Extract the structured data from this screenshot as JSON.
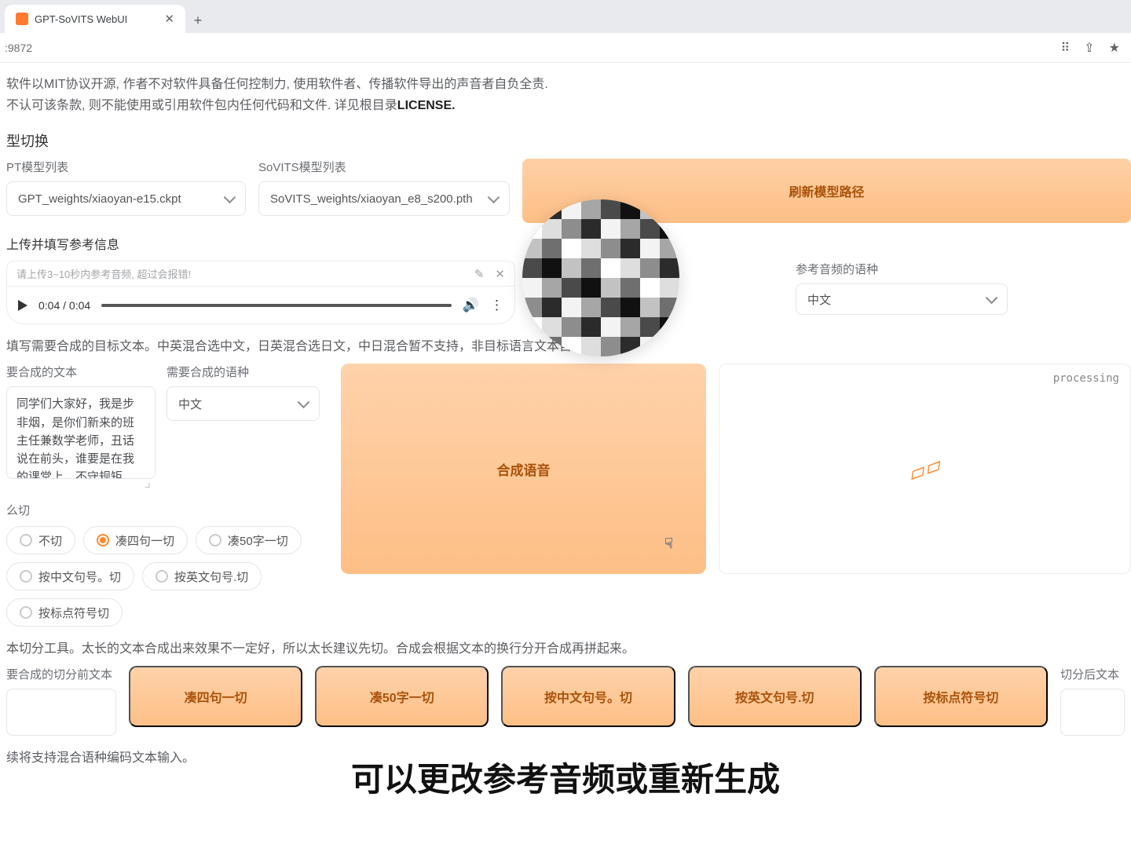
{
  "browser": {
    "tab_title": "GPT-SoVITS WebUI",
    "url": ":9872"
  },
  "disclaimer": {
    "line1": "软件以MIT协议开源, 作者不对软件具备任何控制力, 使用软件者、传播软件导出的声音者自负全责.",
    "line2_a": "不认可该条款, 则不能使用或引用软件包内任何代码和文件. 详见根目录",
    "line2_b": "LICENSE."
  },
  "model_switch": {
    "title": "型切换",
    "gpt_label": "PT模型列表",
    "gpt_value": "GPT_weights/xiaoyan-e15.ckpt",
    "sovits_label": "SoVITS模型列表",
    "sovits_value": "SoVITS_weights/xiaoyan_e8_s200.pth",
    "refresh_btn": "刷新模型路径"
  },
  "ref_audio": {
    "section": "上传并填写参考信息",
    "placeholder": "请上传3~10秒内参考音频, 超过会报错!",
    "time": "0:04 / 0:04",
    "lang_label": "参考音频的语种",
    "lang_value": "中文"
  },
  "target": {
    "section": "填写需要合成的目标文本。中英混合选中文，日英混合选日文，中日混合暂不支持，非目标语言文本自动选",
    "text_label": "要合成的文本",
    "text_value": "同学们大家好，我是步非烟，是你们新来的班主任兼数学老师，丑话说在前头，谁要是在我的课堂上，不守规矩，不好好听话，我饶不了他！",
    "lang_label": "需要合成的语种",
    "lang_value": "中文",
    "synth_btn": "合成语音",
    "processing": "processing"
  },
  "cut_mode": {
    "label": "么切",
    "options": [
      "不切",
      "凑四句一切",
      "凑50字一切",
      "按中文句号。切",
      "按英文句号.切",
      "按标点符号切"
    ],
    "selected": 1
  },
  "cut_tool": {
    "section": "本切分工具。太长的文本合成出来效果不一定好，所以太长建议先切。合成会根据文本的换行分开合成再拼起来。",
    "pre_label": "要合成的切分前文本",
    "btns": [
      "凑四句一切",
      "凑50字一切",
      "按中文句号。切",
      "按英文句号.切",
      "按标点符号切"
    ],
    "post_label": "切分后文本"
  },
  "footer_note": "续将支持混合语种编码文本输入。",
  "caption": "可以更改参考音频或重新生成"
}
